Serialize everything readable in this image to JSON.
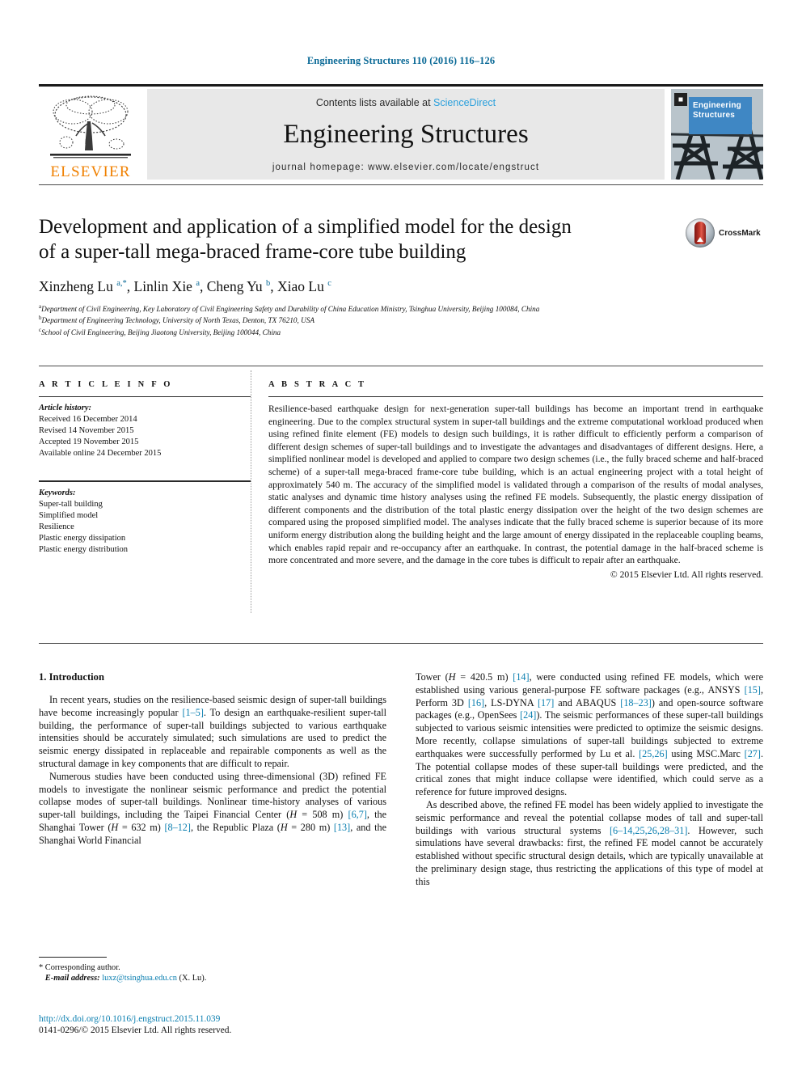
{
  "running_head": "Engineering Structures 110 (2016) 116–126",
  "masthead": {
    "contents_prefix": "Contents lists available at",
    "sciencedirect": "ScienceDirect",
    "journal_title": "Engineering Structures",
    "homepage": "journal homepage: www.elsevier.com/locate/engstruct",
    "publisher": "ELSEVIER",
    "cover_line1": "Engineering",
    "cover_line2": "Structures",
    "colors": {
      "link_blue": "#2ba0dc",
      "elsevier_orange": "#f08000",
      "cover_blue": "#3f87c4"
    }
  },
  "article": {
    "title_line1": "Development and application of a simplified model for the design",
    "title_line2": "of a super-tall mega-braced frame-core tube building",
    "crossmark_label": "CrossMark",
    "authors_html": "Xinzheng Lu <sup>a,</sup><sup>*</sup>, Linlin Xie <sup>a</sup>, Cheng Yu <sup>b</sup>, Xiao Lu <sup>c</sup>",
    "affiliations": [
      {
        "marker": "a",
        "text": "Department of Civil Engineering, Key Laboratory of Civil Engineering Safety and Durability of China Education Ministry, Tsinghua University, Beijing 100084, China"
      },
      {
        "marker": "b",
        "text": "Department of Engineering Technology, University of North Texas, Denton, TX 76210, USA"
      },
      {
        "marker": "c",
        "text": "School of Civil Engineering, Beijing Jiaotong University, Beijing 100044, China"
      }
    ]
  },
  "article_info": {
    "heading": "A R T I C L E   I N F O",
    "history_label": "Article history:",
    "history": [
      "Received 16 December 2014",
      "Revised 14 November 2015",
      "Accepted 19 November 2015",
      "Available online 24 December 2015"
    ],
    "keywords_label": "Keywords:",
    "keywords": [
      "Super-tall building",
      "Simplified model",
      "Resilience",
      "Plastic energy dissipation",
      "Plastic energy distribution"
    ]
  },
  "abstract": {
    "heading": "A B S T R A C T",
    "text": "Resilience-based earthquake design for next-generation super-tall buildings has become an important trend in earthquake engineering. Due to the complex structural system in super-tall buildings and the extreme computational workload produced when using refined finite element (FE) models to design such buildings, it is rather difficult to efficiently perform a comparison of different design schemes of super-tall buildings and to investigate the advantages and disadvantages of different designs. Here, a simplified nonlinear model is developed and applied to compare two design schemes (i.e., the fully braced scheme and half-braced scheme) of a super-tall mega-braced frame-core tube building, which is an actual engineering project with a total height of approximately 540 m. The accuracy of the simplified model is validated through a comparison of the results of modal analyses, static analyses and dynamic time history analyses using the refined FE models. Subsequently, the plastic energy dissipation of different components and the distribution of the total plastic energy dissipation over the height of the two design schemes are compared using the proposed simplified model. The analyses indicate that the fully braced scheme is superior because of its more uniform energy distribution along the building height and the large amount of energy dissipated in the replaceable coupling beams, which enables rapid repair and re-occupancy after an earthquake. In contrast, the potential damage in the half-braced scheme is more concentrated and more severe, and the damage in the core tubes is difficult to repair after an earthquake.",
    "copyright": "© 2015 Elsevier Ltd. All rights reserved."
  },
  "body": {
    "section_heading": "1. Introduction",
    "left_paragraphs_html": [
      "In recent years, studies on the resilience-based seismic design of super-tall buildings have become increasingly popular <span class=\"ref\">[1–5]</span>. To design an earthquake-resilient super-tall building, the performance of super-tall buildings subjected to various earthquake intensities should be accurately simulated; such simulations are used to predict the seismic energy dissipated in replaceable and repairable components as well as the structural damage in key components that are difficult to repair.",
      "Numerous studies have been conducted using three-dimensional (3D) refined FE models to investigate the nonlinear seismic performance and predict the potential collapse modes of super-tall buildings. Nonlinear time-history analyses of various super-tall buildings, including the Taipei Financial Center (<i>H</i> = 508 m) <span class=\"ref\">[6,7]</span>, the Shanghai Tower (<i>H</i> = 632 m) <span class=\"ref\">[8–12]</span>, the Republic Plaza (<i>H</i> = 280 m) <span class=\"ref\">[13]</span>, and the Shanghai World Financial"
    ],
    "right_paragraphs_html": [
      "Tower (<i>H</i> = 420.5 m) <span class=\"ref\">[14]</span>, were conducted using refined FE models, which were established using various general-purpose FE software packages (e.g., ANSYS <span class=\"ref\">[15]</span>, Perform 3D <span class=\"ref\">[16]</span>, LS-DYNA <span class=\"ref\">[17]</span> and ABAQUS <span class=\"ref\">[18–23]</span>) and open-source software packages (e.g., OpenSees <span class=\"ref\">[24]</span>). The seismic performances of these super-tall buildings subjected to various seismic intensities were predicted to optimize the seismic designs. More recently, collapse simulations of super-tall buildings subjected to extreme earthquakes were successfully performed by Lu et al. <span class=\"ref\">[25,26]</span> using MSC.Marc <span class=\"ref\">[27]</span>. The potential collapse modes of these super-tall buildings were predicted, and the critical zones that might induce collapse were identified, which could serve as a reference for future improved designs.",
      "As described above, the refined FE model has been widely applied to investigate the seismic performance and reveal the potential collapse modes of tall and super-tall buildings with various structural systems <span class=\"ref\">[6–14,25,26,28–31]</span>. However, such simulations have several drawbacks: first, the refined FE model cannot be accurately established without specific structural design details, which are typically unavailable at the preliminary design stage, thus restricting the applications of this type of model at this"
    ]
  },
  "footnote": {
    "corresponding": "* Corresponding author.",
    "email_label": "E-mail address:",
    "email": "luxz@tsinghua.edu.cn",
    "email_suffix": "(X. Lu)."
  },
  "footer": {
    "doi": "http://dx.doi.org/10.1016/j.engstruct.2015.11.039",
    "issn_line": "0141-0296/© 2015 Elsevier Ltd. All rights reserved."
  }
}
